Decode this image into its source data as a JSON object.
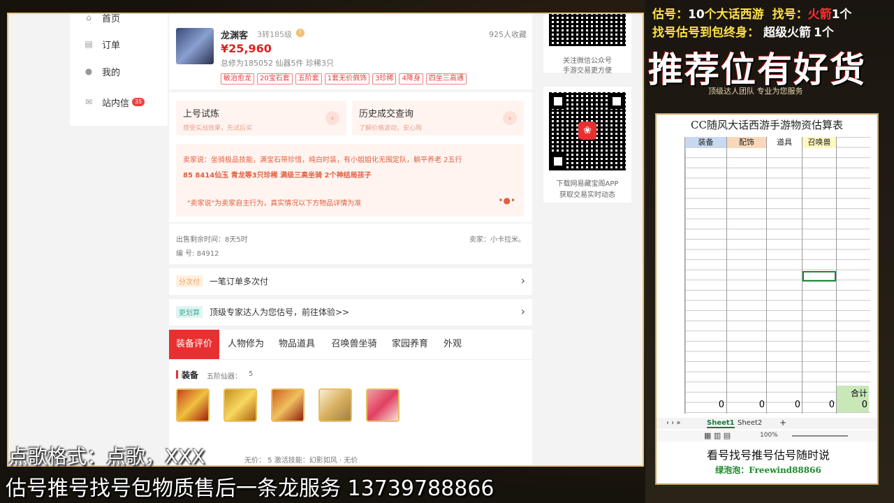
{
  "nav": {
    "items": [
      {
        "label": "首页",
        "icon": "home-icon"
      },
      {
        "label": "订单",
        "icon": "order-icon"
      },
      {
        "label": "我的",
        "icon": "user-icon"
      },
      {
        "label": "站内信",
        "icon": "mail-icon",
        "badge": "35"
      }
    ]
  },
  "listing": {
    "name": "龙渊客",
    "level": "3转185级",
    "favorites": "925人收藏",
    "price": "¥25,960",
    "stats": "总修为185052  仙器5件  珍稀3只",
    "tags": [
      "敏治愈龙",
      "20宝石套",
      "五阶套",
      "1套无价佩饰",
      "3珍稀",
      "4降身",
      "四坐三高通"
    ]
  },
  "actions": {
    "trial_title": "上号试炼",
    "trial_sub": "感受实战效果，先试后买",
    "history_title": "历史成交查询",
    "history_sub": "了解价格波动，安心购"
  },
  "seller_says": {
    "line1": "卖家说：坐骑极品技能，满宝石带珍惜，纯白时装，有小姐姐化无围定队，躺平养老 2五行",
    "line2": "85 8414仙玉 青龙等3只珍稀 满级三高坐骑 2个神结局孩子",
    "disclaimer": "\"卖家说\"为卖家自主行为，真实情况以下方物品详情为准"
  },
  "sale_info": {
    "time_left": "出售剩余时间：8天5时",
    "seller": "卖家：小卡拉米。",
    "serial": "编 号: 84912"
  },
  "installment": {
    "badge": "分次付",
    "text": "一笔订单多次付"
  },
  "estimate": {
    "badge": "更划算",
    "text": "顶级专家达人为您估号，前往体验>>"
  },
  "tabs": [
    "装备评价",
    "人物修为",
    "物品道具",
    "召唤兽坐骑",
    "家园养育",
    "外观"
  ],
  "equipment": {
    "heading": "装备",
    "sub": "五阶仙器：",
    "count": "5",
    "row2": "无价：  5   激活技能：幻影如风 · 无价"
  },
  "qr": {
    "caption1a": "关注微信公众号",
    "caption1b": "手游交易更方便",
    "caption2a": "下载网易藏宝阁APP",
    "caption2b": "获取交易实时动态"
  },
  "promo": {
    "line1_a": "估号：",
    "line1_b": "10",
    "line1_c": "个大话西游",
    "line1_d": "找号：",
    "line1_e": "火箭",
    "line1_f": "1个",
    "line2_a": "找号估号到包终身：",
    "line2_b": "超级火箭",
    "line2_c": "1个",
    "big": "推荐位有好货",
    "small": "顶级达人团队 专业为您服务"
  },
  "sheet": {
    "title": "CC随风大话西游手游物资估算表",
    "headers": [
      "装备",
      "配饰",
      "道具",
      "召唤兽"
    ],
    "total_label": "合计",
    "totals": [
      "0",
      "0",
      "0",
      "0",
      "0"
    ],
    "tab1": "Sheet1",
    "tab2": "Sheet2",
    "zoom": "100%",
    "note1": "看号找号推号估号随时说",
    "note2": "绿泡泡：Freewind88866"
  },
  "overlay": {
    "line1": "点歌格式：点歌，XXX",
    "line2": "估号推号找号包物质售后一条龙服务 13739788866"
  },
  "colors": {
    "accent_red": "#e83030",
    "price_red": "#e02020",
    "promo_yellow": "#ffe14a",
    "promo_red": "#ff3030"
  }
}
